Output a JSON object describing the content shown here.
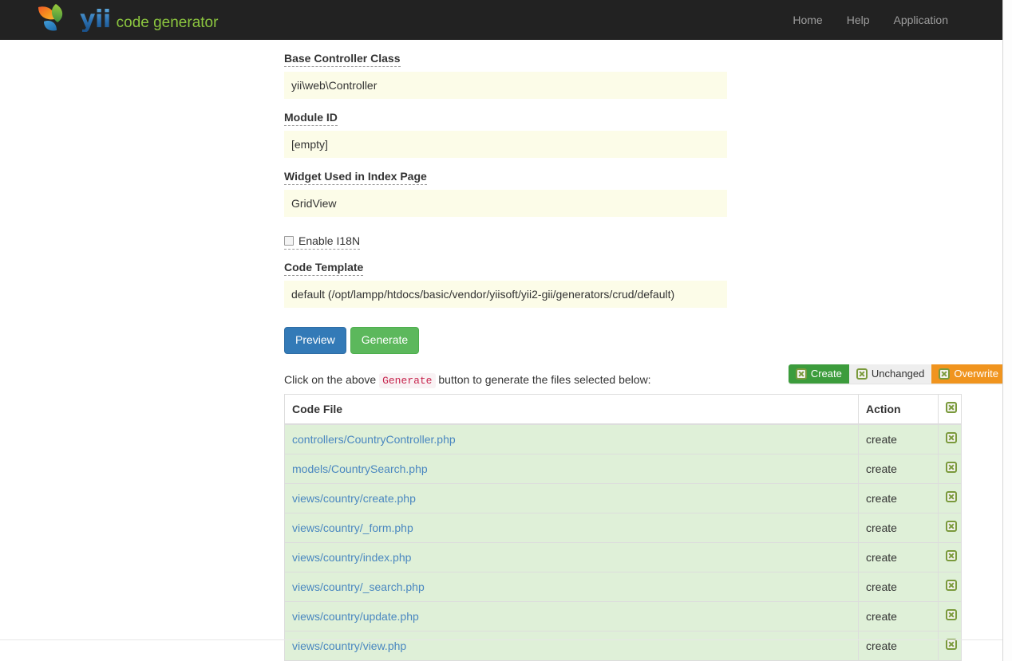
{
  "navbar": {
    "brand": {
      "logo_icon": "yii-leaf-logo-icon",
      "name": "yii",
      "tagline": "code generator",
      "name_color": "#2a6fb0",
      "tagline_color": "#8cc63f"
    },
    "background_color": "#222222",
    "links": [
      {
        "label": "Home"
      },
      {
        "label": "Help"
      },
      {
        "label": "Application"
      }
    ]
  },
  "form": {
    "fields": [
      {
        "label": "Base Controller Class",
        "value": "yii\\web\\Controller"
      },
      {
        "label": "Module ID",
        "value": "[empty]"
      },
      {
        "label": "Widget Used in Index Page",
        "value": "GridView"
      }
    ],
    "checkbox": {
      "label": "Enable I18N",
      "checked": false
    },
    "code_template": {
      "label": "Code Template",
      "value": "default (/opt/lampp/htdocs/basic/vendor/yiisoft/yii2-gii/generators/crud/default)"
    },
    "buttons": {
      "preview": {
        "label": "Preview",
        "color": "#337ab7"
      },
      "generate": {
        "label": "Generate",
        "color": "#5cb85c"
      }
    }
  },
  "hint": {
    "before": "Click on the above",
    "code": "Generate",
    "after": "button to generate the files selected below:"
  },
  "legend": [
    {
      "label": "Create",
      "icon": "broken-image-icon",
      "color": "#3c9c3c"
    },
    {
      "label": "Unchanged",
      "icon": "broken-image-icon",
      "color": "#eeeeee"
    },
    {
      "label": "Overwrite",
      "icon": "broken-image-icon",
      "color": "#f0941e"
    }
  ],
  "table": {
    "headers": {
      "code_file": "Code File",
      "action": "Action",
      "select_all_icon": "broken-image-icon"
    },
    "rows": [
      {
        "file": "controllers/CountryController.php",
        "action": "create",
        "state": "create",
        "checkbox_icon": "broken-image-icon"
      },
      {
        "file": "models/CountrySearch.php",
        "action": "create",
        "state": "create",
        "checkbox_icon": "broken-image-icon"
      },
      {
        "file": "views/country/create.php",
        "action": "create",
        "state": "create",
        "checkbox_icon": "broken-image-icon"
      },
      {
        "file": "views/country/_form.php",
        "action": "create",
        "state": "create",
        "checkbox_icon": "broken-image-icon"
      },
      {
        "file": "views/country/index.php",
        "action": "create",
        "state": "create",
        "checkbox_icon": "broken-image-icon"
      },
      {
        "file": "views/country/_search.php",
        "action": "create",
        "state": "create",
        "checkbox_icon": "broken-image-icon"
      },
      {
        "file": "views/country/update.php",
        "action": "create",
        "state": "create",
        "checkbox_icon": "broken-image-icon"
      },
      {
        "file": "views/country/view.php",
        "action": "create",
        "state": "create",
        "checkbox_icon": "broken-image-icon"
      }
    ],
    "row_background": "#dff0d8",
    "link_color": "#4a87c0"
  }
}
